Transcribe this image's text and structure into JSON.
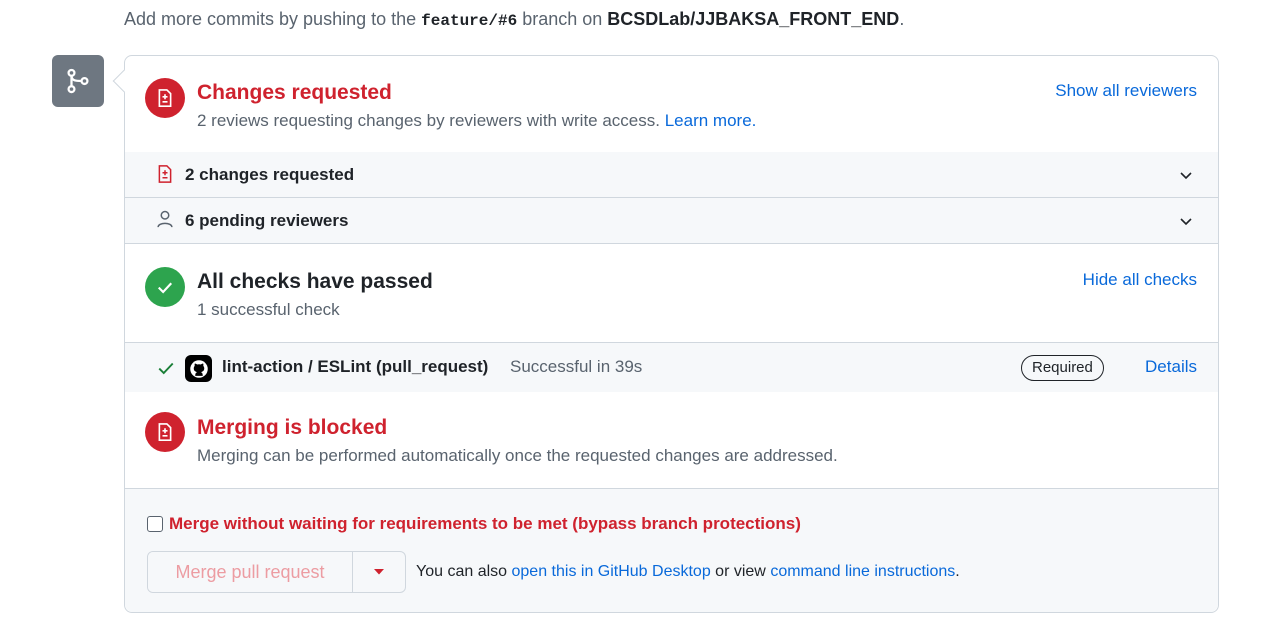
{
  "top_note": {
    "prefix": "Add more commits by pushing to the",
    "branch": "feature/#6",
    "middle": "branch on",
    "repo": "BCSDLab/JJBAKSA_FRONT_END",
    "suffix": "."
  },
  "reviews": {
    "title": "Changes requested",
    "description": "2 reviews requesting changes by reviewers with write access.",
    "learn_more": "Learn more.",
    "show_all": "Show all reviewers",
    "rows": [
      {
        "label": "2 changes requested",
        "icon": "file-diff-icon"
      },
      {
        "label": "6 pending reviewers",
        "icon": "person-icon"
      }
    ]
  },
  "checks": {
    "title": "All checks have passed",
    "description": "1 successful check",
    "hide_all": "Hide all checks",
    "items": [
      {
        "name": "lint-action / ESLint (pull_request)",
        "status": "Successful in 39s",
        "badge": "Required",
        "details": "Details"
      }
    ]
  },
  "merging": {
    "title": "Merging is blocked",
    "description": "Merging can be performed automatically once the requested changes are addressed."
  },
  "footer": {
    "bypass_label": "Merge without waiting for requirements to be met (bypass branch protections)",
    "bypass_checked": false,
    "merge_button": "Merge pull request",
    "alt_prefix": "You can also",
    "desktop_link": "open this in GitHub Desktop",
    "alt_middle": "or view",
    "cli_link": "command line instructions",
    "alt_suffix": "."
  },
  "colors": {
    "danger": "#cf222e",
    "success": "#2da44e",
    "link": "#0969da",
    "muted": "#59636e",
    "badge_gray": "#6e7781"
  }
}
